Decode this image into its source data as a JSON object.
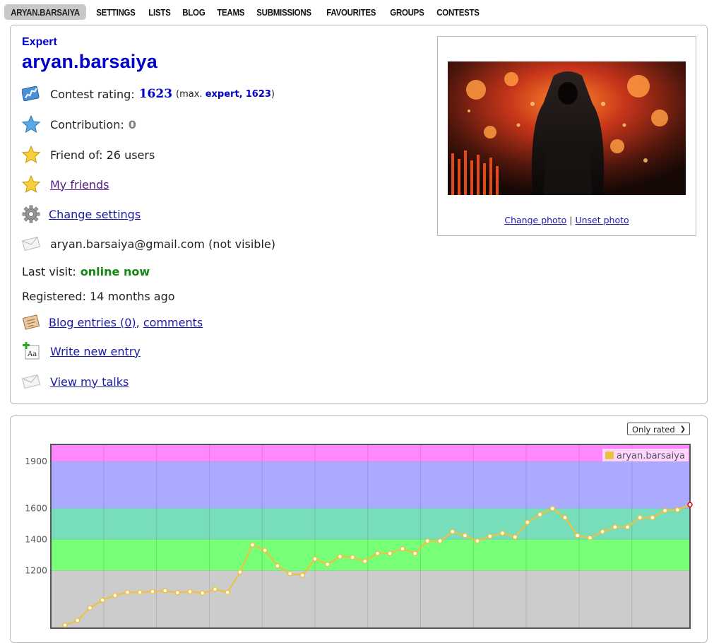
{
  "nav": [
    {
      "label": "ARYAN.BARSAIYA",
      "active": true
    },
    {
      "label": "SETTINGS"
    },
    {
      "label": "LISTS"
    },
    {
      "label": "BLOG"
    },
    {
      "label": "TEAMS"
    },
    {
      "label": "SUBMISSIONS"
    },
    {
      "label": "FAVOURITES"
    },
    {
      "label": "GROUPS"
    },
    {
      "label": "CONTESTS"
    }
  ],
  "profile": {
    "rank": "Expert",
    "handle": "aryan.barsaiya",
    "rating_label": "Contest rating:",
    "rating": "1623",
    "max_prefix": "(max.",
    "max_rank": "expert,",
    "max_rating": "1623",
    "max_suffix": ")",
    "contribution_label": "Contribution:",
    "contribution": "0",
    "friend_of": "Friend of: 26 users",
    "my_friends": "My friends",
    "change_settings": "Change settings",
    "email": "aryan.barsaiya@gmail.com (not visible)",
    "last_visit_label": "Last visit:",
    "last_visit": "online now",
    "registered": "Registered: 14 months ago",
    "blog_entries": "Blog entries (0)",
    "comma": ",",
    "comments": "comments",
    "write_entry": "Write new entry",
    "view_talks": "View my talks",
    "change_photo": "Change photo",
    "sep": "|",
    "unset_photo": "Unset photo"
  },
  "chart_filter": {
    "selected": "Only rated"
  },
  "chart_data": {
    "type": "line",
    "series": [
      {
        "name": "aryan.barsaiya",
        "color": "#edc240",
        "values": [
          850,
          880,
          960,
          1010,
          1040,
          1060,
          1060,
          1065,
          1070,
          1058,
          1065,
          1055,
          1080,
          1060,
          1190,
          1365,
          1330,
          1230,
          1180,
          1170,
          1275,
          1240,
          1290,
          1285,
          1260,
          1310,
          1310,
          1340,
          1310,
          1390,
          1390,
          1450,
          1425,
          1390,
          1420,
          1440,
          1415,
          1510,
          1560,
          1598,
          1540,
          1425,
          1410,
          1450,
          1480,
          1480,
          1540,
          1540,
          1585,
          1590,
          1623
        ]
      }
    ],
    "yticks": [
      1200,
      1400,
      1600,
      1900
    ],
    "ylim": [
      830,
      2010
    ],
    "bands": [
      {
        "from": 830,
        "to": 1200,
        "color": "#cccccc"
      },
      {
        "from": 1200,
        "to": 1400,
        "color": "#77ff77"
      },
      {
        "from": 1400,
        "to": 1600,
        "color": "#77ddbb"
      },
      {
        "from": 1600,
        "to": 1900,
        "color": "#aaaaff"
      },
      {
        "from": 1900,
        "to": 2010,
        "color": "#ff88ff"
      }
    ],
    "legend_position": "top-right"
  }
}
